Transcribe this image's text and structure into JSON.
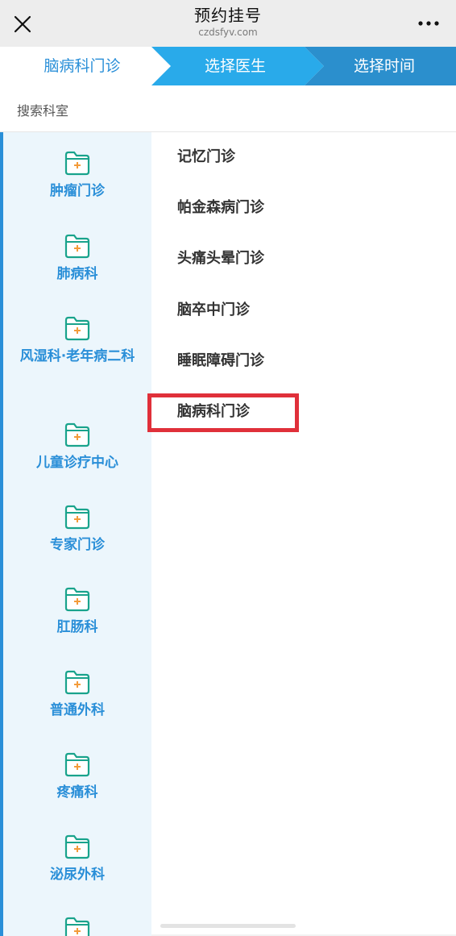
{
  "navbar": {
    "title": "预约挂号",
    "subtitle": "czdsfyv.com",
    "close_icon": "close-icon",
    "more_icon": "more-icon"
  },
  "steps": [
    {
      "label": "脑病科门诊",
      "state": "done"
    },
    {
      "label": "选择医生",
      "state": "current"
    },
    {
      "label": "选择时间",
      "state": "pending"
    }
  ],
  "search": {
    "label": "搜索科室"
  },
  "departments": [
    {
      "label": "肿瘤门诊"
    },
    {
      "label": "肺病科"
    },
    {
      "label": "风湿科·老年病二科"
    },
    {
      "label": "儿童诊疗中心"
    },
    {
      "label": "专家门诊"
    },
    {
      "label": "肛肠科"
    },
    {
      "label": "普通外科"
    },
    {
      "label": "疼痛科"
    },
    {
      "label": "泌尿外科"
    },
    {
      "label": ""
    }
  ],
  "clinics": [
    {
      "label": "记忆门诊"
    },
    {
      "label": "帕金森病门诊"
    },
    {
      "label": "头痛头晕门诊"
    },
    {
      "label": "脑卒中门诊"
    },
    {
      "label": "睡眠障碍门诊"
    },
    {
      "label": "脑病科门诊",
      "highlighted": true
    }
  ],
  "colors": {
    "accent": "#2a8fd8",
    "step_current": "#29aaea",
    "step_pending": "#2b8fcd",
    "highlight_border": "#e0303a",
    "dept_background": "#ecf6fc",
    "folder_icon": "#19a38c",
    "folder_plus": "#f39b3a"
  }
}
